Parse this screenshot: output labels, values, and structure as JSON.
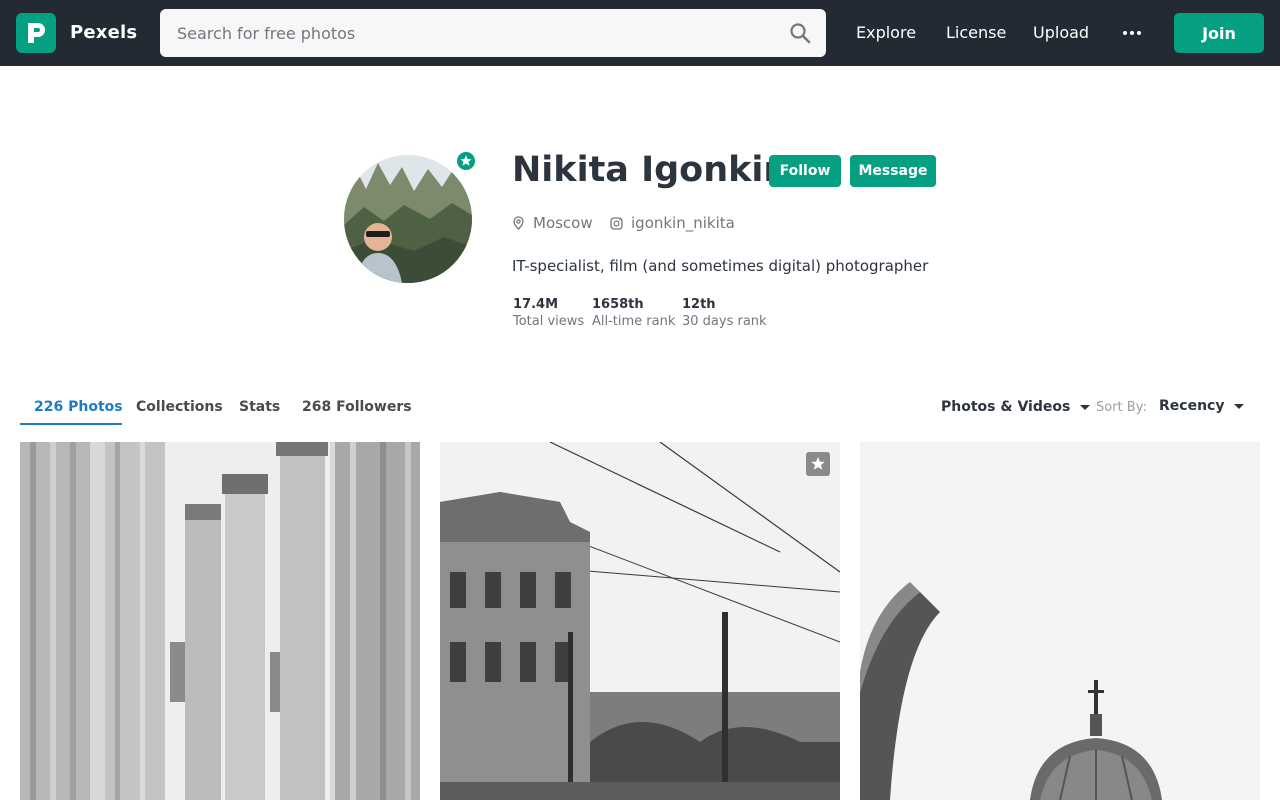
{
  "app": {
    "brand": "Pexels",
    "search_placeholder": "Search for free photos",
    "nav": [
      "Explore",
      "License",
      "Upload"
    ],
    "join_label": "Join",
    "accent_color": "#05a081",
    "header_color": "#232a34"
  },
  "profile": {
    "name": "Nikita Igonkin",
    "follow_label": "Follow",
    "message_label": "Message",
    "location": "Moscow",
    "instagram": "igonkin_nikita",
    "bio": "IT-specialist, film (and sometimes digital) photographer",
    "stats": [
      {
        "value": "17.4M",
        "label": "Total views"
      },
      {
        "value": "1658th",
        "label": "All-time rank"
      },
      {
        "value": "12th",
        "label": "30 days rank"
      }
    ]
  },
  "tabs": {
    "items": [
      "226 Photos",
      "Collections",
      "Stats",
      "268 Followers"
    ],
    "active": "226 Photos",
    "filter_label": "Photos & Videos",
    "sort_label": "Sort By:",
    "sort_value": "Recency",
    "link_color": "#1c7dc7"
  },
  "icons": {
    "search": "search-icon",
    "more": "more-dots-icon",
    "location": "map-pin-icon",
    "instagram": "instagram-icon",
    "badge": "star-badge-icon",
    "bookmark": "star-bookmark-icon"
  }
}
